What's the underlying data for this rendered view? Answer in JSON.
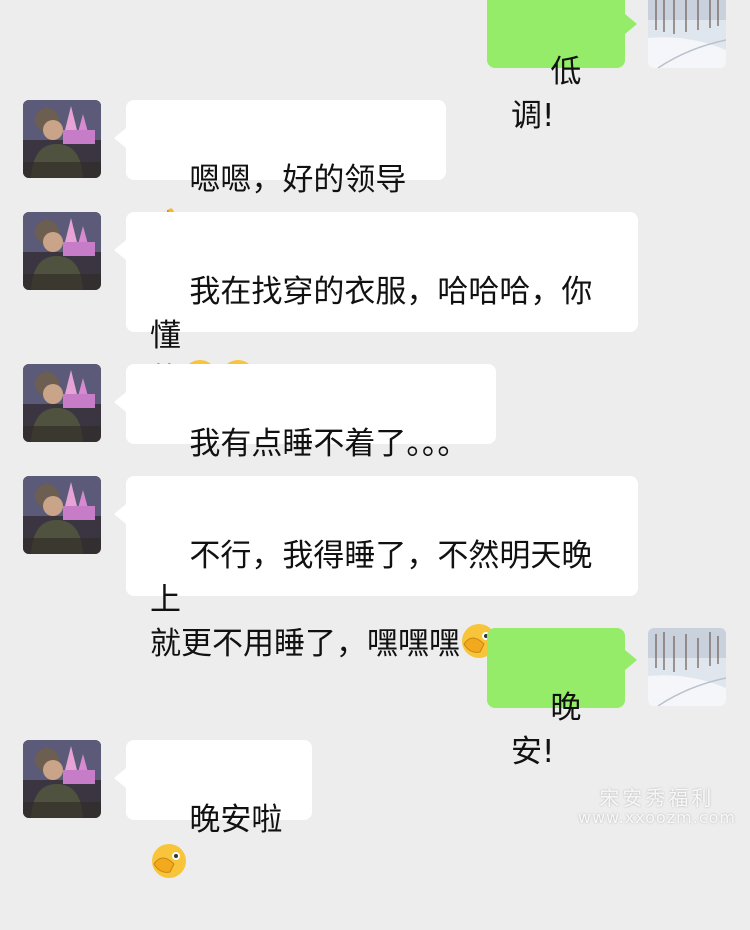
{
  "messages": [
    {
      "side": "out",
      "text": "低调!"
    },
    {
      "side": "in",
      "text": "嗯嗯，好的领导",
      "emoji": "folded-hands-icon"
    },
    {
      "side": "in",
      "text": "我在找穿的衣服，哈哈哈，你懂",
      "text2": "的",
      "emoji": "smirk-face-icon"
    },
    {
      "side": "in",
      "text": "我有点睡不着了。。。"
    },
    {
      "side": "in",
      "text": "不行，我得睡了，不然明天晚上",
      "text2": "就更不用睡了，嘿嘿嘿",
      "emoji": "facepalm-peek-icon"
    },
    {
      "side": "out",
      "text": "晚安!"
    },
    {
      "side": "in",
      "text": "晚安啦",
      "emoji": "facepalm-peek-icon"
    }
  ],
  "watermark": {
    "line1": "宋安秀福利",
    "line2": "www.xxoozm.com"
  },
  "colors": {
    "background": "#ededed",
    "incoming": "#ffffff",
    "outgoing": "#95ec69"
  }
}
